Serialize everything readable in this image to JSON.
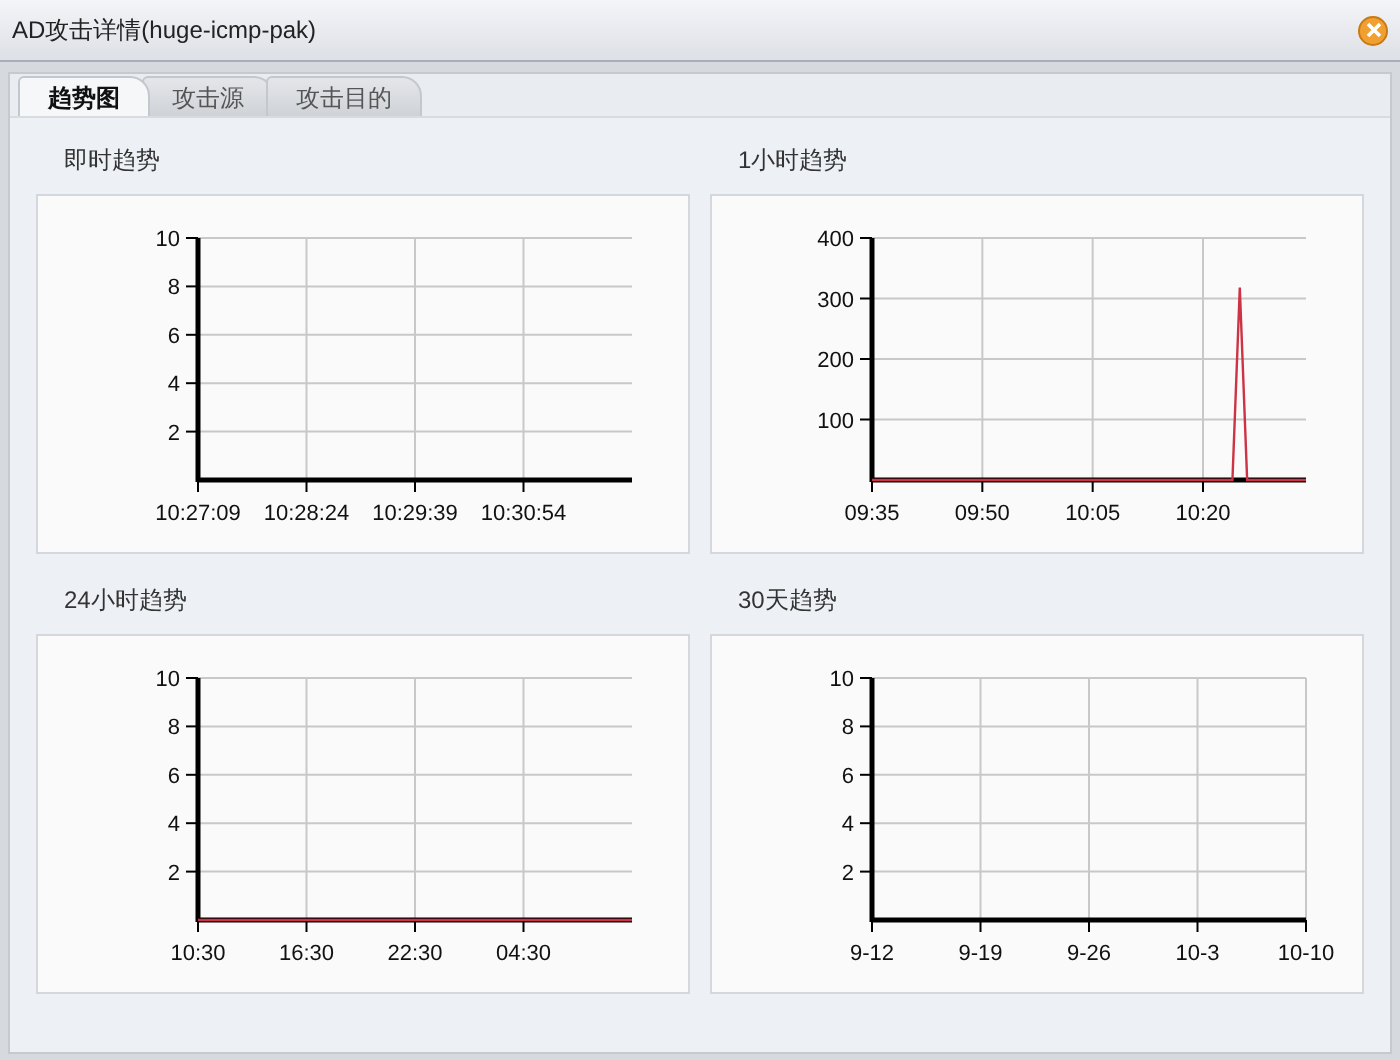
{
  "window": {
    "title": "AD攻击详情(huge-icmp-pak)"
  },
  "tabs": [
    {
      "label": "趋势图",
      "selected": true
    },
    {
      "label": "攻击源",
      "selected": false
    },
    {
      "label": "攻击目的",
      "selected": false
    }
  ],
  "panels": [
    {
      "title": "即时趋势",
      "chart_data": {
        "type": "line",
        "grid": true,
        "ylim": [
          0,
          10
        ],
        "yticks": [
          2,
          4,
          6,
          8,
          10
        ],
        "categories": [
          "10:27:09",
          "10:28:24",
          "10:29:39",
          "10:30:54",
          null
        ]
      }
    },
    {
      "title": "1小时趋势",
      "chart_data": {
        "type": "line",
        "grid": true,
        "ylim": [
          0,
          400
        ],
        "yticks": [
          100,
          200,
          300,
          400
        ],
        "categories": [
          "09:35",
          null,
          null,
          null,
          null,
          null,
          null,
          null,
          null,
          null,
          null,
          null,
          null,
          null,
          null,
          "09:50",
          null,
          null,
          null,
          null,
          null,
          null,
          null,
          null,
          null,
          null,
          null,
          null,
          null,
          null,
          "10:05",
          null,
          null,
          null,
          null,
          null,
          null,
          null,
          null,
          null,
          null,
          null,
          null,
          null,
          null,
          "10:20",
          null,
          null,
          null,
          null,
          null,
          null,
          null,
          null,
          null,
          null,
          null,
          null,
          null,
          null
        ],
        "series": [
          {
            "color": "#cc3344",
            "values": [
              0,
              0,
              0,
              0,
              0,
              0,
              0,
              0,
              0,
              0,
              0,
              0,
              0,
              0,
              0,
              0,
              0,
              0,
              0,
              0,
              0,
              0,
              0,
              0,
              0,
              0,
              0,
              0,
              0,
              0,
              0,
              0,
              0,
              0,
              0,
              0,
              0,
              0,
              0,
              0,
              0,
              0,
              0,
              0,
              0,
              0,
              0,
              0,
              0,
              0,
              318,
              0,
              0,
              0,
              0,
              0,
              0,
              0,
              0,
              0
            ]
          }
        ]
      }
    },
    {
      "title": "24小时趋势",
      "chart_data": {
        "type": "line",
        "grid": true,
        "ylim": [
          0,
          10
        ],
        "yticks": [
          2,
          4,
          6,
          8,
          10
        ],
        "categories": [
          "10:30",
          "16:30",
          "22:30",
          "04:30",
          null
        ],
        "series": [
          {
            "color": "#cc3344",
            "values": [
              0,
              0,
              0,
              0,
              0
            ]
          }
        ]
      }
    },
    {
      "title": "30天趋势",
      "chart_data": {
        "type": "line",
        "grid": true,
        "ylim": [
          0,
          10
        ],
        "yticks": [
          2,
          4,
          6,
          8,
          10
        ],
        "categories": [
          "9-12",
          "9-19",
          "9-26",
          "10-3",
          "10-10"
        ]
      }
    }
  ]
}
